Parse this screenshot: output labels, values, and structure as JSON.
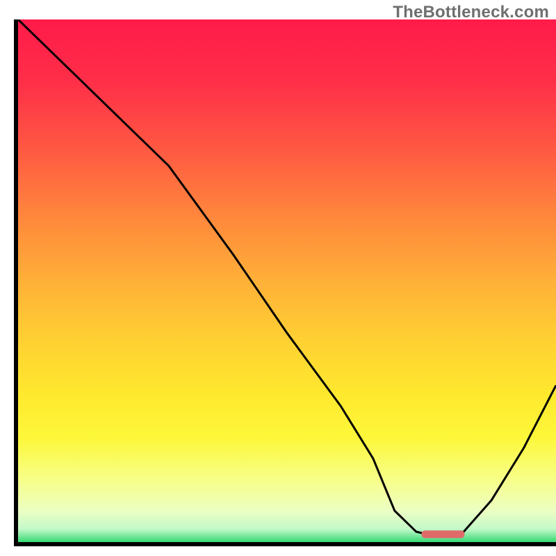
{
  "watermark": "TheBottleneck.com",
  "chart_data": {
    "type": "line",
    "title": "",
    "xlabel": "",
    "ylabel": "",
    "xlim": [
      0,
      100
    ],
    "ylim": [
      0,
      100
    ],
    "grid": false,
    "background_gradient": {
      "stops": [
        {
          "offset": 0.0,
          "color": "#ff1a4a"
        },
        {
          "offset": 0.12,
          "color": "#ff2f48"
        },
        {
          "offset": 0.25,
          "color": "#ff5942"
        },
        {
          "offset": 0.38,
          "color": "#ff883c"
        },
        {
          "offset": 0.5,
          "color": "#ffb038"
        },
        {
          "offset": 0.62,
          "color": "#ffd232"
        },
        {
          "offset": 0.72,
          "color": "#ffe92e"
        },
        {
          "offset": 0.8,
          "color": "#fdf73a"
        },
        {
          "offset": 0.88,
          "color": "#f7ff88"
        },
        {
          "offset": 0.94,
          "color": "#ecffc3"
        },
        {
          "offset": 0.975,
          "color": "#c3f9c9"
        },
        {
          "offset": 1.0,
          "color": "#35d974"
        }
      ]
    },
    "curve": {
      "x": [
        0,
        10,
        20,
        28,
        40,
        50,
        60,
        66,
        70,
        74,
        78,
        82,
        88,
        94,
        100
      ],
      "y": [
        100,
        90,
        80,
        72,
        55,
        40,
        26,
        16,
        6,
        2,
        1,
        1,
        8,
        18,
        30
      ]
    },
    "marker": {
      "x_center": 79,
      "y": 1.5,
      "width": 8,
      "color": "#e06a6a"
    },
    "axes_color": "#000000",
    "curve_color": "#000000",
    "curve_width": 3
  }
}
